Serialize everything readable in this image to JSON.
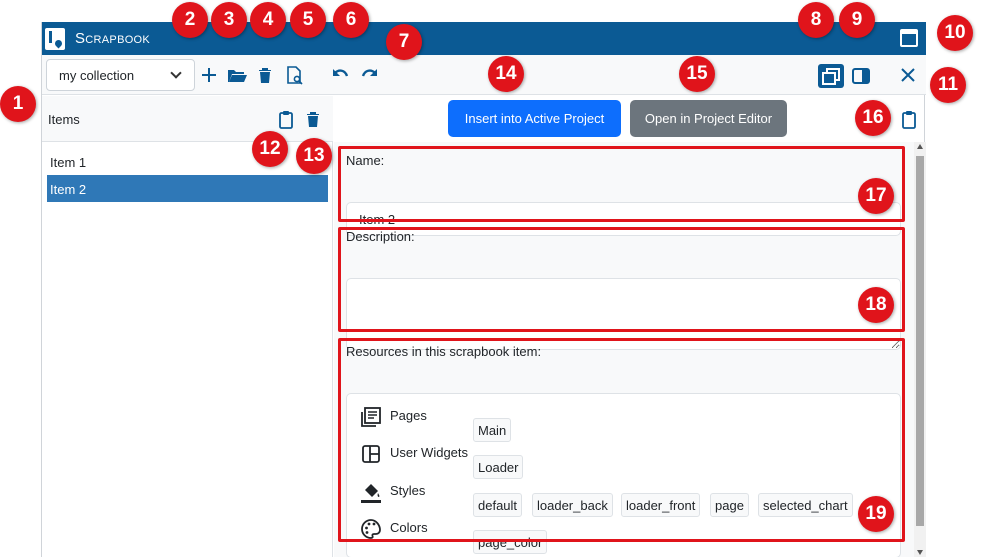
{
  "titlebar": {
    "title": "Scrapbook"
  },
  "toolbar": {
    "collection_value": "my collection"
  },
  "items_panel": {
    "title": "Items",
    "items": [
      {
        "label": "Item 1",
        "selected": false
      },
      {
        "label": "Item 2",
        "selected": true
      }
    ]
  },
  "actions": {
    "insert_label": "Insert into Active Project",
    "open_label": "Open in Project Editor"
  },
  "form": {
    "name_label": "Name:",
    "name_value": "Item 2",
    "description_label": "Description:",
    "description_value": "",
    "resources_label": "Resources in this scrapbook item:",
    "resources": [
      {
        "type": "Pages",
        "icon": "pages-icon",
        "tags": [
          "Main"
        ]
      },
      {
        "type": "User Widgets",
        "icon": "widgets-icon",
        "tags": [
          "Loader"
        ]
      },
      {
        "type": "Styles",
        "icon": "paint-bucket-icon",
        "tags": [
          "default",
          "loader_back",
          "loader_front",
          "page",
          "selected_chart"
        ]
      },
      {
        "type": "Colors",
        "icon": "palette-icon",
        "tags": [
          "page_color"
        ]
      }
    ]
  },
  "callouts": [
    "1",
    "2",
    "3",
    "4",
    "5",
    "6",
    "7",
    "8",
    "9",
    "10",
    "11",
    "12",
    "13",
    "14",
    "15",
    "16",
    "17",
    "18",
    "19"
  ],
  "colors": {
    "accent": "#0b5a94",
    "primary": "#0d6efd",
    "secondary": "#6c757d",
    "selected": "#2f78b7",
    "annotation": "#e0141b"
  }
}
